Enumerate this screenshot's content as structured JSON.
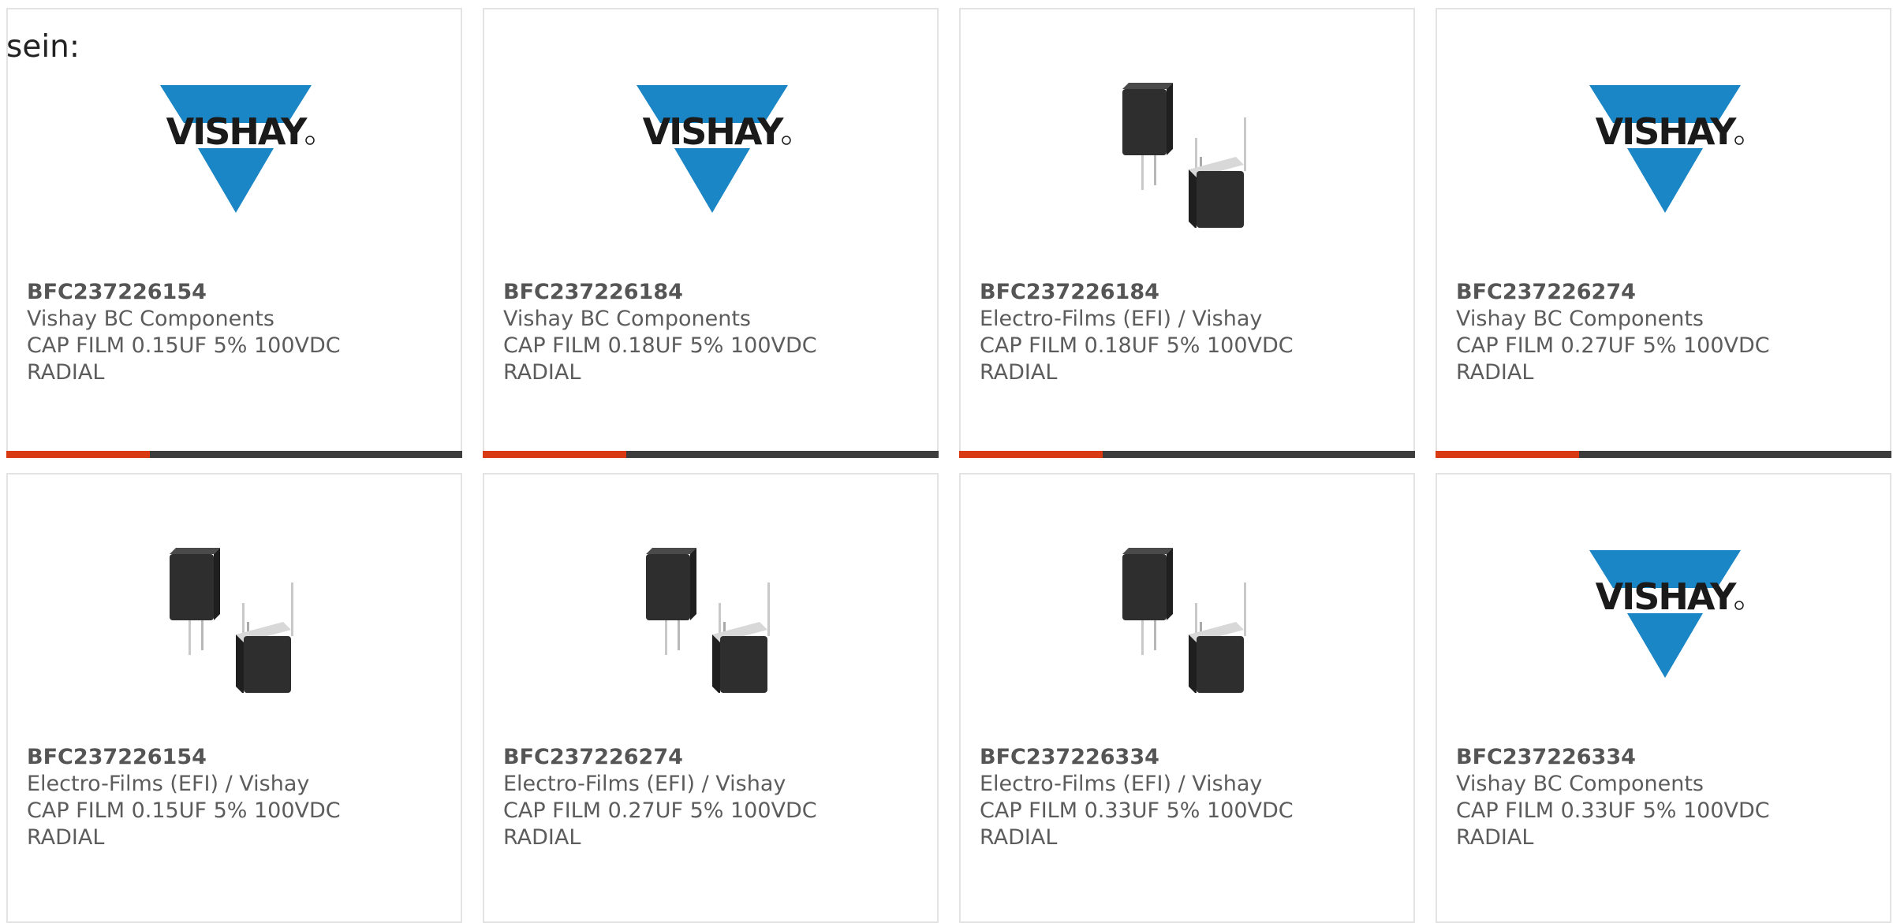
{
  "intro_text": "sein:",
  "colors": {
    "vishay_blue": "#1a86c6",
    "vishay_text": "#1a1a1a",
    "accent_orange": "#d93a12",
    "bar_dark": "#3d3d3d"
  },
  "logo_text": "VISHAY",
  "products": [
    {
      "part_number": "BFC237226154",
      "manufacturer": "Vishay BC Components",
      "description": "CAP FILM 0.15UF 5% 100VDC",
      "package": "RADIAL",
      "image": "vishay-logo",
      "progress_bar": true
    },
    {
      "part_number": "BFC237226184",
      "manufacturer": "Vishay BC Components",
      "description": "CAP FILM 0.18UF 5% 100VDC",
      "package": "RADIAL",
      "image": "vishay-logo",
      "progress_bar": true
    },
    {
      "part_number": "BFC237226184",
      "manufacturer": "Electro-Films (EFI) / Vishay",
      "description": "CAP FILM 0.18UF 5% 100VDC",
      "package": "RADIAL",
      "image": "capacitor-photo",
      "progress_bar": true
    },
    {
      "part_number": "BFC237226274",
      "manufacturer": "Vishay BC Components",
      "description": "CAP FILM 0.27UF 5% 100VDC",
      "package": "RADIAL",
      "image": "vishay-logo",
      "progress_bar": true
    },
    {
      "part_number": "BFC237226154",
      "manufacturer": "Electro-Films (EFI) / Vishay",
      "description": "CAP FILM 0.15UF 5% 100VDC",
      "package": "RADIAL",
      "image": "capacitor-photo",
      "progress_bar": false
    },
    {
      "part_number": "BFC237226274",
      "manufacturer": "Electro-Films (EFI) / Vishay",
      "description": "CAP FILM 0.27UF 5% 100VDC",
      "package": "RADIAL",
      "image": "capacitor-photo",
      "progress_bar": false
    },
    {
      "part_number": "BFC237226334",
      "manufacturer": "Electro-Films (EFI) / Vishay",
      "description": "CAP FILM 0.33UF 5% 100VDC",
      "package": "RADIAL",
      "image": "capacitor-photo",
      "progress_bar": false
    },
    {
      "part_number": "BFC237226334",
      "manufacturer": "Vishay BC Components",
      "description": "CAP FILM 0.33UF 5% 100VDC",
      "package": "RADIAL",
      "image": "vishay-logo",
      "progress_bar": false
    }
  ]
}
